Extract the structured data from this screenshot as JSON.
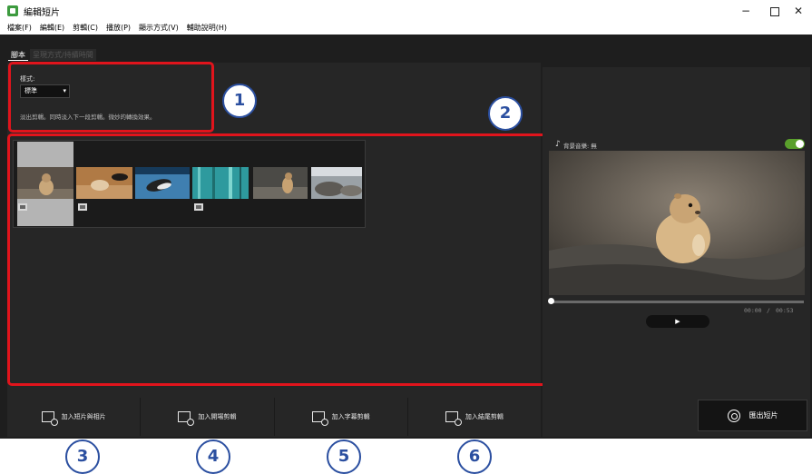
{
  "window": {
    "title": "編輯短片",
    "minimize": "−",
    "close": "✕"
  },
  "menu": [
    "檔案(F)",
    "編輯(E)",
    "剪輯(C)",
    "播放(P)",
    "顯示方式(V)",
    "輔助說明(H)"
  ],
  "tabs": [
    {
      "label": "腳本",
      "active": true
    },
    {
      "label": "呈現方式/持續時間",
      "active": false
    }
  ],
  "style_panel": {
    "label": "樣式:",
    "selected": "標準",
    "caret": "▾",
    "description": "淡出剪輯。同時淡入下一段剪輯。微妙的轉換效果。"
  },
  "timeline": {
    "clips": [
      {
        "name": "prairie-dog",
        "has_movie_icon": true
      },
      {
        "name": "rabbit",
        "has_movie_icon": true
      },
      {
        "name": "seal",
        "has_movie_icon": false
      },
      {
        "name": "aquarium",
        "has_movie_icon": true
      },
      {
        "name": "prairie-dog-2",
        "has_movie_icon": false
      },
      {
        "name": "rocky-shore",
        "has_movie_icon": false
      }
    ]
  },
  "actions": [
    {
      "label": "加入短片與相片",
      "icon": "add-media-icon"
    },
    {
      "label": "加入開場剪輯",
      "icon": "add-opening-icon"
    },
    {
      "label": "加入字幕剪輯",
      "icon": "add-caption-icon"
    },
    {
      "label": "加入結尾剪輯",
      "icon": "add-ending-icon"
    }
  ],
  "preview": {
    "bgm_label": "背景音樂: 無",
    "bgm_icon": "♪",
    "time_current": "00:00",
    "time_sep": "/",
    "time_total": "00:53",
    "play": "▶",
    "export_label": "匯出短片",
    "progress": 0
  },
  "callouts": [
    "1",
    "2",
    "3",
    "4",
    "5",
    "6"
  ],
  "colors": {
    "highlight": "#e0141c",
    "callout": "#2b4fa0",
    "toggle_on": "#5aa02c"
  }
}
